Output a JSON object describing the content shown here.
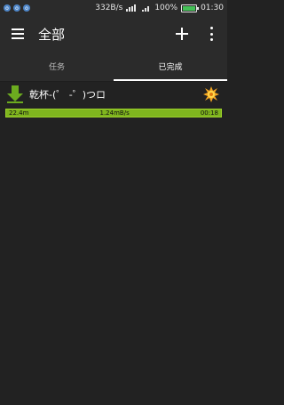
{
  "status_bar": {
    "speed": "332B/s",
    "battery_percent": "100%",
    "time": "01:30",
    "notification_icons": [
      "app-notification-icon",
      "app-notification-icon",
      "app-notification-icon"
    ]
  },
  "app_bar": {
    "title": "全部",
    "menu_icon": "menu-icon",
    "add_icon": "add-icon",
    "more_icon": "more-vert-icon"
  },
  "tabs": [
    {
      "label": "任务",
      "active": false
    },
    {
      "label": "已完成",
      "active": true
    }
  ],
  "downloads": [
    {
      "title": "乾杯-(゜ -゜)つロ",
      "size": "22.4m",
      "speed": "1.24mB/s",
      "elapsed": "00:18",
      "progress_fraction": 1.0
    }
  ],
  "colors": {
    "background": "#222222",
    "bar": "#2b2b2b",
    "progress": "#7fb51e",
    "accent_green": "#6cab1f"
  }
}
